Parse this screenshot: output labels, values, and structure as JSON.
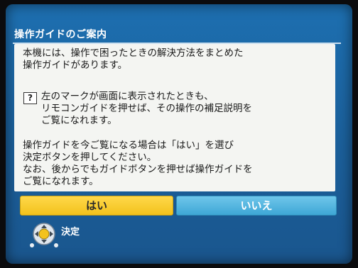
{
  "dialog": {
    "title": "操作ガイドのご案内",
    "paragraph1": "本機には、操作で困ったときの解決方法をまとめた\n操作ガイドがあります。",
    "help_mark": "?",
    "paragraph2": "左のマークが画面に表示されたときも、\nリモコンガイドを押せば、その操作の補足説明を\nご覧になれます。",
    "paragraph3": "操作ガイドを今ご覧になる場合は「はい」を選び\n決定ボタンを押してください。\nなお、後からでもガイドボタンを押せば操作ガイドを\nご覧になれます。"
  },
  "buttons": {
    "yes_label": "はい",
    "no_label": "いいえ"
  },
  "footer": {
    "confirm_label": "決定",
    "confirm_icon": "remote-dpad-icon"
  },
  "colors": {
    "background_blue": "#1b5f9a",
    "panel": "#f4f5f2",
    "yes_button": "#f2c21c",
    "no_button": "#3ea7d6"
  }
}
